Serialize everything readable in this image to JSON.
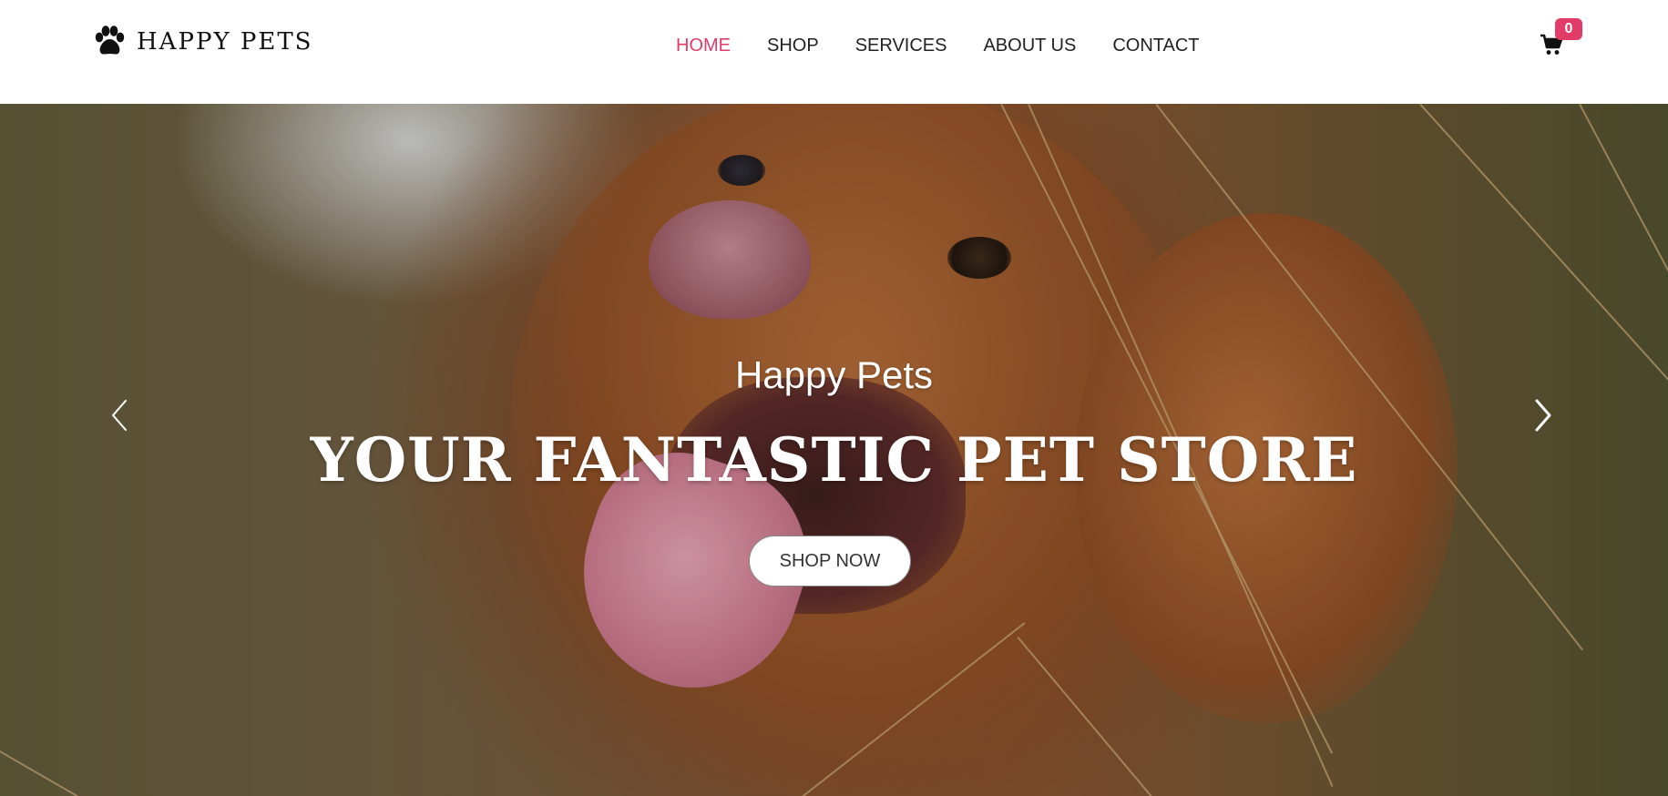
{
  "header": {
    "logo_text": "HAPPY PETS",
    "nav": [
      {
        "label": "HOME",
        "active": true
      },
      {
        "label": "SHOP",
        "active": false
      },
      {
        "label": "SERVICES",
        "active": false
      },
      {
        "label": "ABOUT US",
        "active": false
      },
      {
        "label": "CONTACT",
        "active": false
      }
    ],
    "cart_count": "0",
    "icons": {
      "logo": "paw-icon",
      "cart": "cart-icon"
    }
  },
  "hero": {
    "subtitle": "Happy Pets",
    "title": "YOUR FANTASTIC PET STORE",
    "cta_label": "SHOP NOW",
    "icons": {
      "prev": "chevron-left-icon",
      "next": "chevron-right-icon"
    }
  },
  "colors": {
    "accent": "#e13c68",
    "nav_text": "#222222",
    "header_bg": "#ffffff",
    "hero_text": "#ffffff"
  }
}
